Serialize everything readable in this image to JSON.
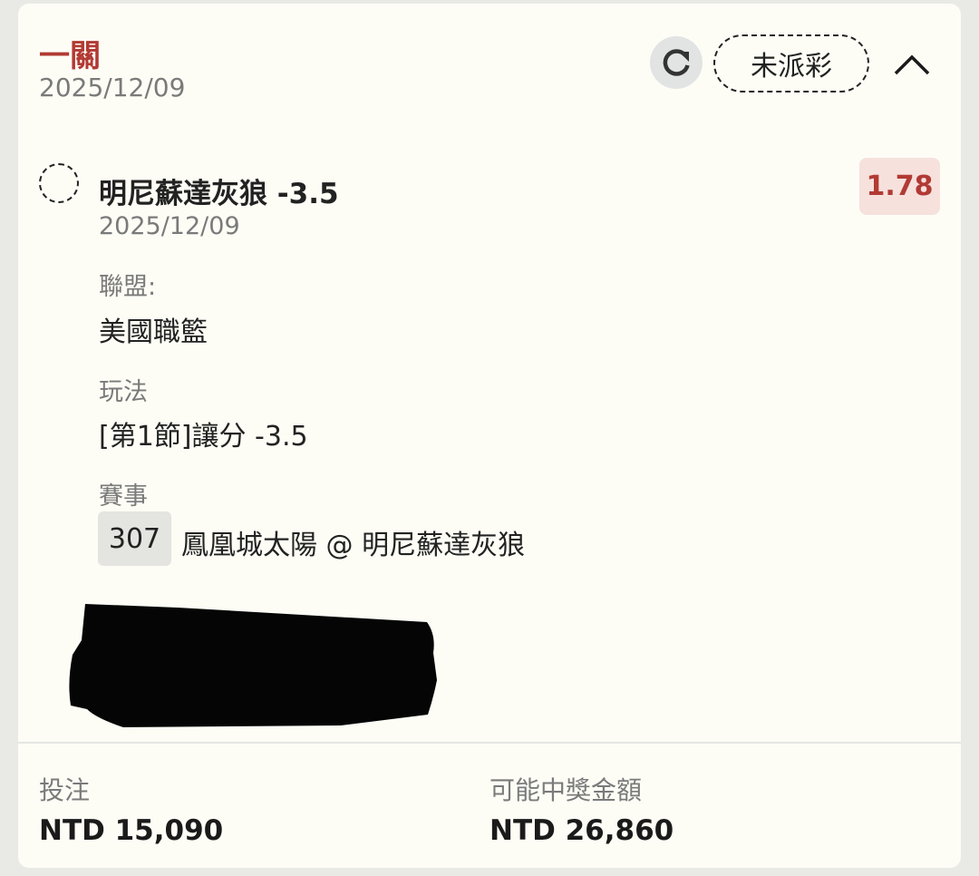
{
  "header": {
    "title": "一關",
    "date": "2025/12/09",
    "status": "未派彩"
  },
  "selection": {
    "name": "明尼蘇達灰狼 -3.5",
    "date": "2025/12/09",
    "odds": "1.78",
    "league_label": "聯盟:",
    "league_value": "美國職籃",
    "market_label": "玩法",
    "market_value": "[第1節]讓分 -3.5",
    "event_label": "賽事",
    "event_id": "307",
    "event_name": "鳳凰城太陽 @ 明尼蘇達灰狼"
  },
  "footer": {
    "stake_label": "投注",
    "stake_value": "NTD 15,090",
    "payout_label": "可能中獎金額",
    "payout_value": "NTD 26,860"
  },
  "colors": {
    "accent": "#b23a34",
    "odds_bg": "#f6e1dd",
    "card_bg": "#fdfdf6"
  },
  "icons": {
    "refresh": "refresh-icon",
    "collapse": "chevron-up-icon"
  }
}
